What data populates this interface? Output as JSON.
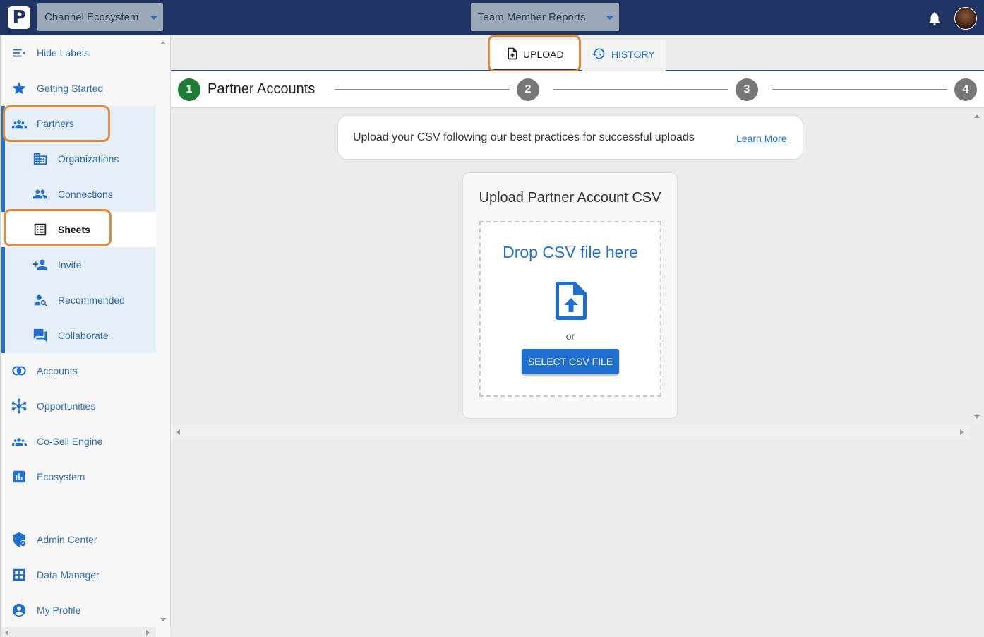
{
  "header": {
    "logo_letter": "P",
    "workspace_select": "Channel Ecosystem",
    "report_select": "Team Member Reports",
    "bell_icon": "bell-icon",
    "avatar_icon": "user-avatar"
  },
  "sidebar": {
    "items": [
      {
        "label": "Hide Labels",
        "icon": "collapse-menu-icon"
      },
      {
        "label": "Getting Started",
        "icon": "star-icon"
      },
      {
        "label": "Partners",
        "icon": "partners-icon"
      },
      {
        "label": "Organizations",
        "icon": "building-icon"
      },
      {
        "label": "Connections",
        "icon": "people-icon"
      },
      {
        "label": "Sheets",
        "icon": "sheet-list-icon"
      },
      {
        "label": "Invite",
        "icon": "person-add-icon"
      },
      {
        "label": "Recommended",
        "icon": "person-search-icon"
      },
      {
        "label": "Collaborate",
        "icon": "chat-icon"
      },
      {
        "label": "Accounts",
        "icon": "overlap-circles-icon"
      },
      {
        "label": "Opportunities",
        "icon": "hub-icon"
      },
      {
        "label": "Co-Sell Engine",
        "icon": "group-icon"
      },
      {
        "label": "Ecosystem",
        "icon": "bar-chart-icon"
      },
      {
        "label": "Admin Center",
        "icon": "shield-icon"
      },
      {
        "label": "Data Manager",
        "icon": "grid-icon"
      },
      {
        "label": "My Profile",
        "icon": "account-circle-icon"
      }
    ]
  },
  "tabs": {
    "upload": "UPLOAD",
    "history": "HISTORY"
  },
  "stepper": {
    "current_step": "1",
    "current_title": "Partner Accounts",
    "step2": "2",
    "step3": "3",
    "step4": "4",
    "active_color": "#1e7b34",
    "inactive_color": "#777777"
  },
  "banner": {
    "text": "Upload your CSV following our best practices for successful uploads",
    "link": "Learn More"
  },
  "upload_card": {
    "title": "Upload Partner Account CSV",
    "drop_heading": "Drop CSV file here",
    "or_text": "or",
    "button": "SELECT CSV FILE"
  },
  "colors": {
    "header_bg": "#1f3462",
    "accent": "#1f6fd1",
    "highlight": "#e08a3c"
  }
}
